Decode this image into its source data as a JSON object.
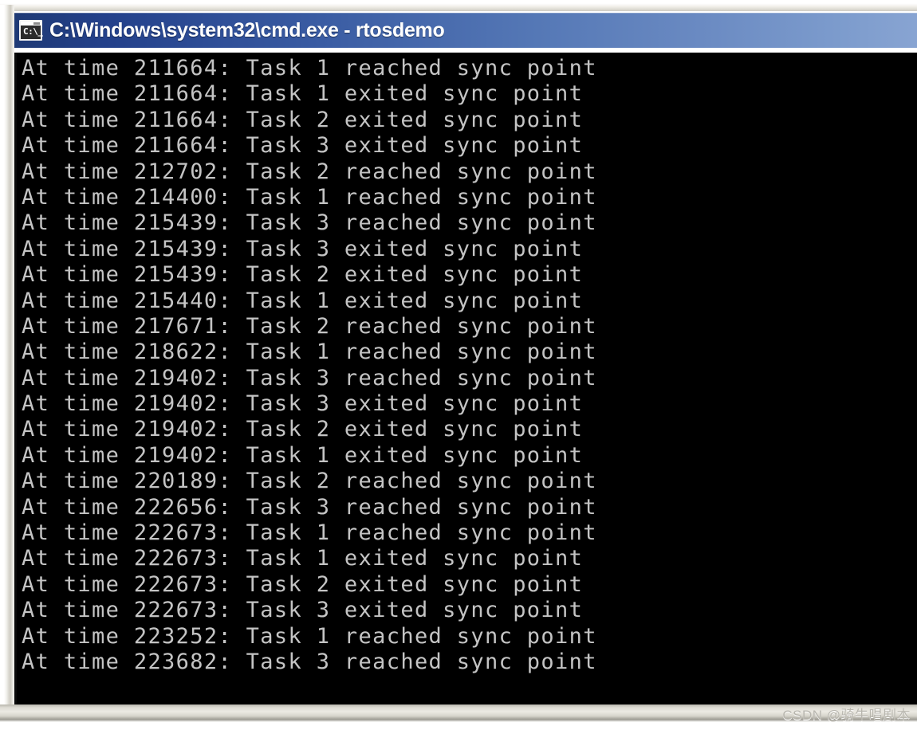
{
  "window": {
    "title": "C:\\Windows\\system32\\cmd.exe - rtosdemo",
    "icon_name": "cmd-console-icon",
    "icon_glyph": "C:\\_",
    "titlebar_color_left": "#1f3a75",
    "titlebar_color_right": "#88a4d2",
    "console_background": "#000000",
    "console_text_color": "#c4c4c4"
  },
  "console": {
    "lines": [
      "At time 211664: Task 1 reached sync point",
      "At time 211664: Task 1 exited sync point",
      "At time 211664: Task 2 exited sync point",
      "At time 211664: Task 3 exited sync point",
      "At time 212702: Task 2 reached sync point",
      "At time 214400: Task 1 reached sync point",
      "At time 215439: Task 3 reached sync point",
      "At time 215439: Task 3 exited sync point",
      "At time 215439: Task 2 exited sync point",
      "At time 215440: Task 1 exited sync point",
      "At time 217671: Task 2 reached sync point",
      "At time 218622: Task 1 reached sync point",
      "At time 219402: Task 3 reached sync point",
      "At time 219402: Task 3 exited sync point",
      "At time 219402: Task 2 exited sync point",
      "At time 219402: Task 1 exited sync point",
      "At time 220189: Task 2 reached sync point",
      "At time 222656: Task 3 reached sync point",
      "At time 222673: Task 1 reached sync point",
      "At time 222673: Task 1 exited sync point",
      "At time 222673: Task 2 exited sync point",
      "At time 222673: Task 3 exited sync point",
      "At time 223252: Task 1 reached sync point",
      "At time 223682: Task 3 reached sync point"
    ]
  },
  "watermark": {
    "text": "CSDN @骑牛唱剧本"
  }
}
